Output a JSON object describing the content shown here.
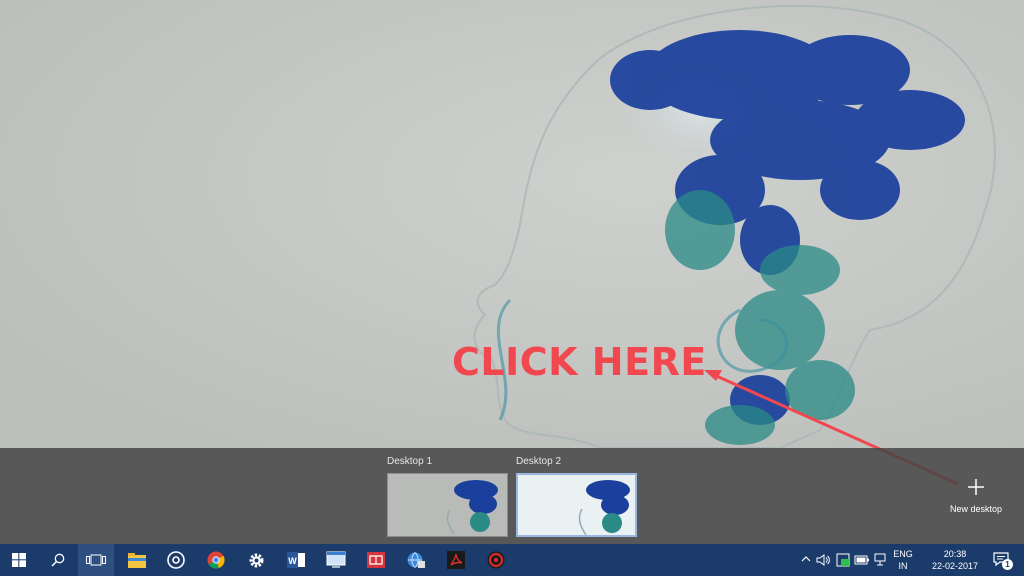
{
  "annotation": {
    "text": "CLICK HERE",
    "color": "#f0484e"
  },
  "task_view": {
    "desktops": [
      {
        "label": "Desktop 1",
        "active": false
      },
      {
        "label": "Desktop 2",
        "active": true
      }
    ],
    "new_desktop_label": "New desktop"
  },
  "taskbar": {
    "apps": [
      {
        "name": "start",
        "icon": "windows-logo-icon"
      },
      {
        "name": "search",
        "icon": "search-icon"
      },
      {
        "name": "task-view",
        "icon": "task-view-icon"
      },
      {
        "name": "file-explorer",
        "icon": "folder-icon"
      },
      {
        "name": "groove-music",
        "icon": "disc-icon"
      },
      {
        "name": "chrome",
        "icon": "chrome-icon"
      },
      {
        "name": "settings",
        "icon": "gear-icon"
      },
      {
        "name": "word",
        "icon": "word-icon"
      },
      {
        "name": "app-window",
        "icon": "window-app-icon"
      },
      {
        "name": "store-app",
        "icon": "red-app-icon"
      },
      {
        "name": "network-app",
        "icon": "globe-app-icon"
      },
      {
        "name": "acrobat",
        "icon": "pdf-icon"
      },
      {
        "name": "red-circle-app",
        "icon": "red-circle-icon"
      }
    ],
    "tray": {
      "language_line1": "ENG",
      "language_line2": "IN",
      "time": "20:38",
      "date": "22-02-2017",
      "notification_count": "1"
    }
  },
  "colors": {
    "taskbar": "#1b3b6a",
    "ink_blue": "#1a3f9c",
    "ink_teal": "#2a8a86"
  }
}
